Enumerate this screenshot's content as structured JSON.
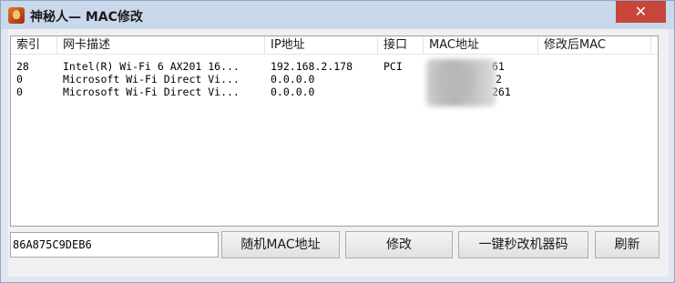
{
  "window": {
    "title": "神秘人— MAC修改",
    "close_glyph": "✕",
    "icon": "app-icon"
  },
  "table": {
    "columns": [
      "索引",
      "网卡描述",
      "IP地址",
      "接口",
      "MAC地址",
      "修改后MAC"
    ],
    "rows": [
      [
        "28",
        "Intel(R) Wi-Fi 6 AX201 16...",
        "192.168.2.178",
        "PCI",
        "61",
        ""
      ],
      [
        "0",
        "Microsoft Wi-Fi Direct Vi...",
        "0.0.0.0",
        "",
        "2",
        ""
      ],
      [
        "0",
        "Microsoft Wi-Fi Direct Vi...",
        "0.0.0.0",
        "",
        "261",
        ""
      ]
    ]
  },
  "controls": {
    "mac_value": "86A875C9DEB6",
    "random_mac_label": "随机MAC地址",
    "modify_label": "修改",
    "one_click_label": "一键秒改机器码",
    "refresh_label": "刷新"
  },
  "colors": {
    "close_button": "#c7453a",
    "titlebar": "#c9d8ea"
  }
}
